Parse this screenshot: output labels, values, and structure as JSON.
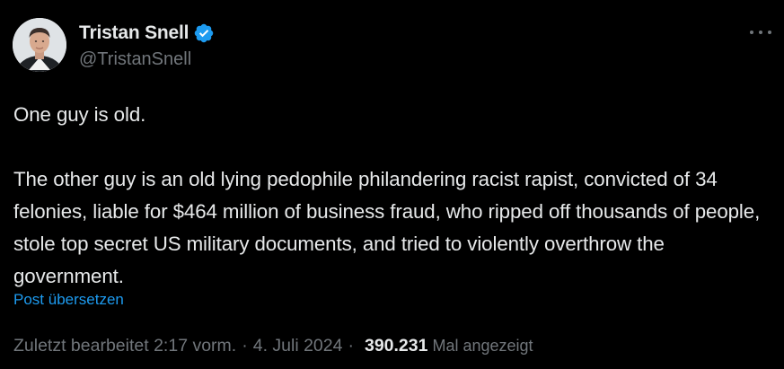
{
  "author": {
    "display_name": "Tristan Snell",
    "handle": "@TristanSnell",
    "verified": true,
    "verified_color": "#1d9bf0"
  },
  "tweet": {
    "text": "One guy is old.\n\nThe other guy is an old lying pedophile philandering racist rapist, convicted of 34 felonies, liable for $464 million of business fraud, who ripped off thousands of people, stole top secret US military documents, and tried to violently overthrow the government.",
    "translate_label": "Post übersetzen"
  },
  "meta": {
    "edited_time": "Zuletzt bearbeitet 2:17 vorm.",
    "separator": "·",
    "date": "4. Juli 2024",
    "views_count": "390.231",
    "views_label": "Mal angezeigt"
  },
  "icons": {
    "avatar": "profile-photo",
    "verified": "verified-badge-icon",
    "more": "more-options-icon"
  },
  "colors": {
    "background": "#000000",
    "text": "#e7e9ea",
    "secondary": "#71767b",
    "link": "#1d9bf0"
  }
}
